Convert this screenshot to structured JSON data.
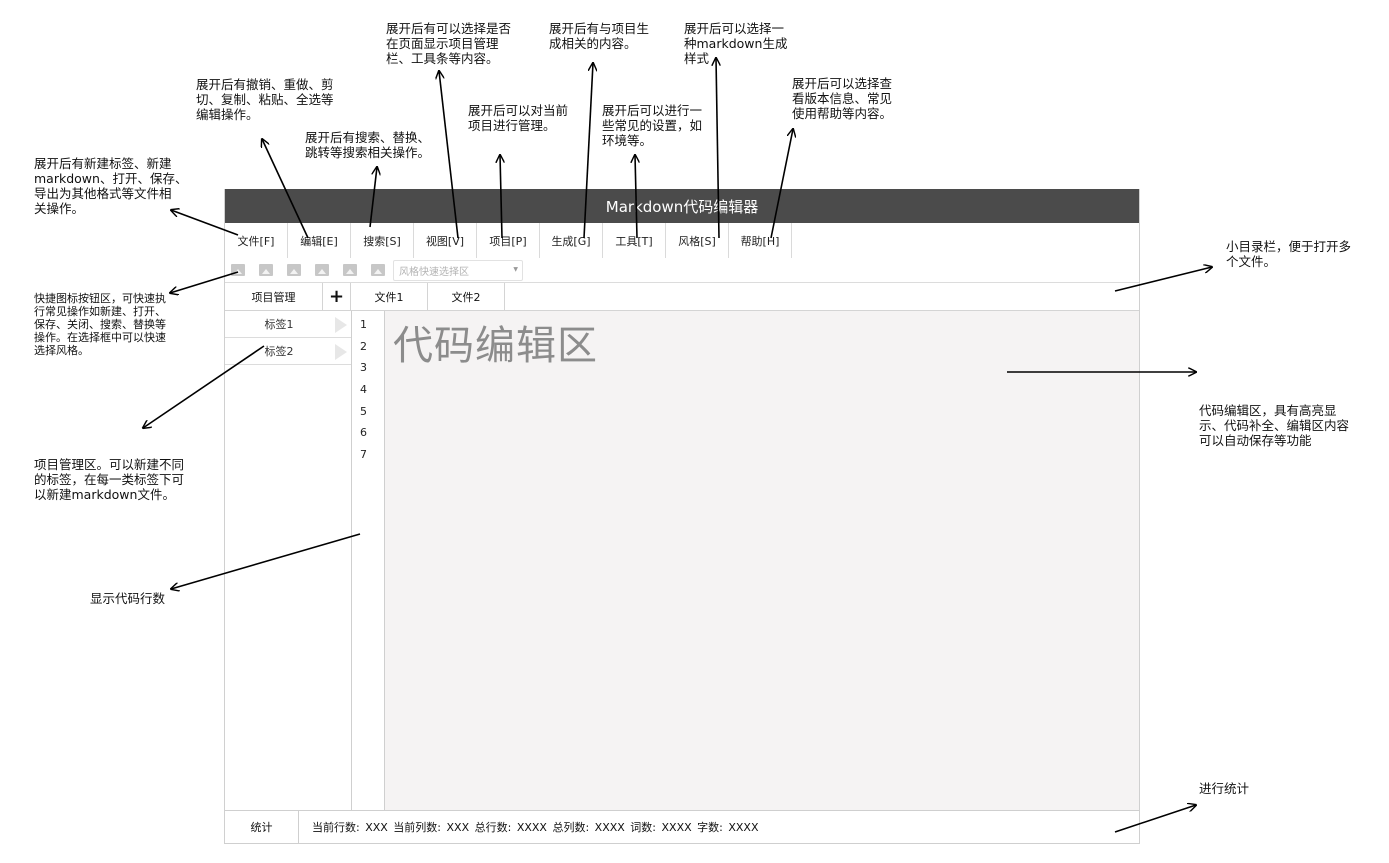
{
  "app": {
    "title": "Markdown代码编辑器",
    "menus": [
      "文件[F]",
      "编辑[E]",
      "搜索[S]",
      "视图[V]",
      "项目[P]",
      "生成[G]",
      "工具[T]",
      "风格[S]",
      "帮助[H]"
    ],
    "toolbar": {
      "icon_names": [
        "image-icon",
        "image-icon",
        "image-icon",
        "image-icon",
        "image-icon",
        "image-icon"
      ],
      "style_placeholder": "风格快速选择区"
    },
    "project": {
      "header": "项目管理",
      "add": "+",
      "tags": [
        "标签1",
        "标签2"
      ]
    },
    "files": [
      "文件1",
      "文件2"
    ],
    "line_numbers": [
      "1",
      "2",
      "3",
      "4",
      "5",
      "6",
      "7"
    ],
    "editor_placeholder": "代码编辑区",
    "status": {
      "label": "统计",
      "text": "当前行数: XXX   当前列数: XXX   总行数: XXXX  总列数: XXXX     词数: XXXX   字数: XXXX"
    }
  },
  "annotations": {
    "file": "展开后有新建标签、新建\nmarkdown、打开、保存、\n导出为其他格式等文件相\n关操作。",
    "edit": "展开后有撤销、重做、剪\n切、复制、粘贴、全选等\n编辑操作。",
    "search": "展开后有搜索、替换、\n跳转等搜索相关操作。",
    "view": "展开后有可以选择是否\n在页面显示项目管理\n栏、工具条等内容。",
    "project": "展开后可以对当前\n项目进行管理。",
    "generate": "展开后有与项目生\n成相关的内容。",
    "tools": "展开后可以进行一\n些常见的设置，如\n环境等。",
    "style": "展开后可以选择一\n种markdown生成\n样式",
    "help": "展开后可以选择查\n看版本信息、常见\n使用帮助等内容。",
    "shortcut": "快捷图标按钮区，可快速执\n行常见操作如新建、打开、\n保存、关闭、搜索、替换等\n操作。在选择框中可以快速\n选择风格。",
    "project_area": "项目管理区。可以新建不同\n的标签，在每一类标签下可\n以新建markdown文件。",
    "line_numbers": "显示代码行数",
    "tabs": "小目录栏，便于打开多\n个文件。",
    "editor": "代码编辑区，具有高亮显\n示、代码补全、编辑区内容\n可以自动保存等功能",
    "stats": "进行统计"
  }
}
